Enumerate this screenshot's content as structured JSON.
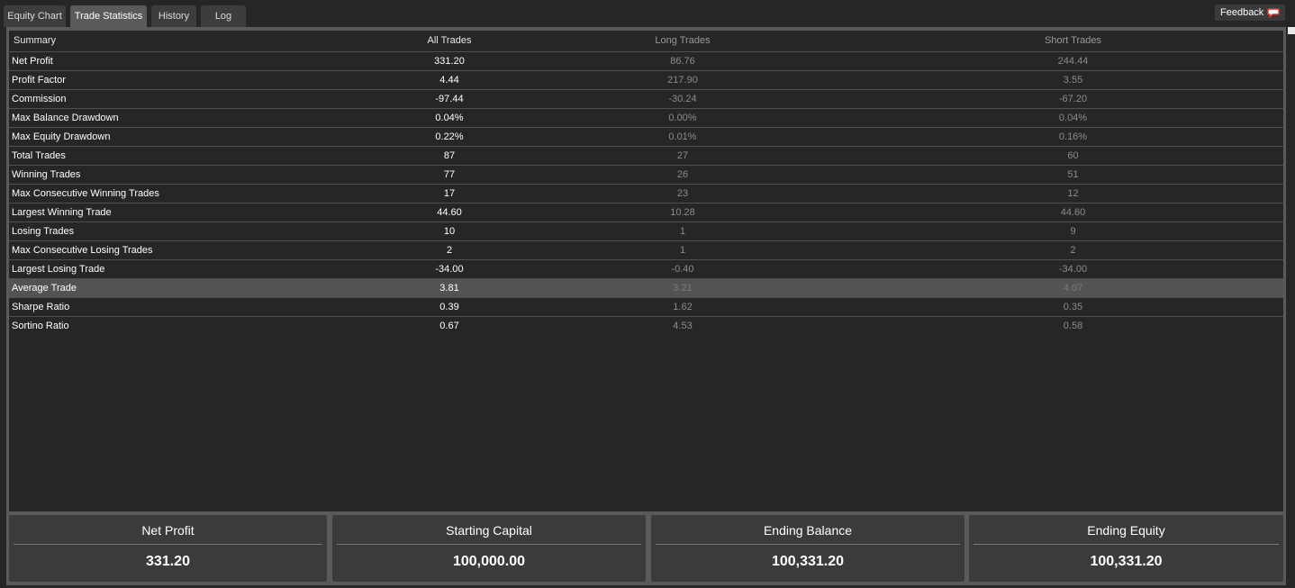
{
  "tabs": [
    {
      "label": "Equity Chart",
      "active": false
    },
    {
      "label": "Trade Statistics",
      "active": true
    },
    {
      "label": "History",
      "active": false
    },
    {
      "label": "Log",
      "active": false
    }
  ],
  "feedback": {
    "label": "Feedback",
    "icon": "speech-bubble-icon",
    "icon_color": "#e03030"
  },
  "table": {
    "headers": [
      "Summary",
      "All Trades",
      "Long Trades",
      "Short Trades"
    ],
    "rows": [
      [
        "Net Profit",
        "331.20",
        "86.76",
        "244.44"
      ],
      [
        "Profit Factor",
        "4.44",
        "217.90",
        "3.55"
      ],
      [
        "Commission",
        "-97.44",
        "-30.24",
        "-67.20"
      ],
      [
        "Max Balance Drawdown",
        "0.04%",
        "0.00%",
        "0.04%"
      ],
      [
        "Max Equity Drawdown",
        "0.22%",
        "0.01%",
        "0.16%"
      ],
      [
        "Total Trades",
        "87",
        "27",
        "60"
      ],
      [
        "Winning Trades",
        "77",
        "26",
        "51"
      ],
      [
        "Max Consecutive Winning Trades",
        "17",
        "23",
        "12"
      ],
      [
        "Largest Winning Trade",
        "44.60",
        "10.28",
        "44.60"
      ],
      [
        "Losing Trades",
        "10",
        "1",
        "9"
      ],
      [
        "Max Consecutive Losing Trades",
        "2",
        "1",
        "2"
      ],
      [
        "Largest Losing Trade",
        "-34.00",
        "-0.40",
        "-34.00"
      ],
      [
        "Average Trade",
        "3.81",
        "3.21",
        "4.07"
      ],
      [
        "Sharpe Ratio",
        "0.39",
        "1.62",
        "0.35"
      ],
      [
        "Sortino Ratio",
        "0.67",
        "4.53",
        "0.58"
      ]
    ],
    "highlighted_row": 12
  },
  "cards": [
    {
      "label": "Net Profit",
      "value": "331.20"
    },
    {
      "label": "Starting Capital",
      "value": "100,000.00"
    },
    {
      "label": "Ending Balance",
      "value": "100,331.20"
    },
    {
      "label": "Ending Equity",
      "value": "100,331.20"
    }
  ],
  "colors": {
    "background": "#262626",
    "panel_border": "#5a5a5a",
    "highlight_row": "#535353",
    "dim_text": "#8c8c8c"
  }
}
